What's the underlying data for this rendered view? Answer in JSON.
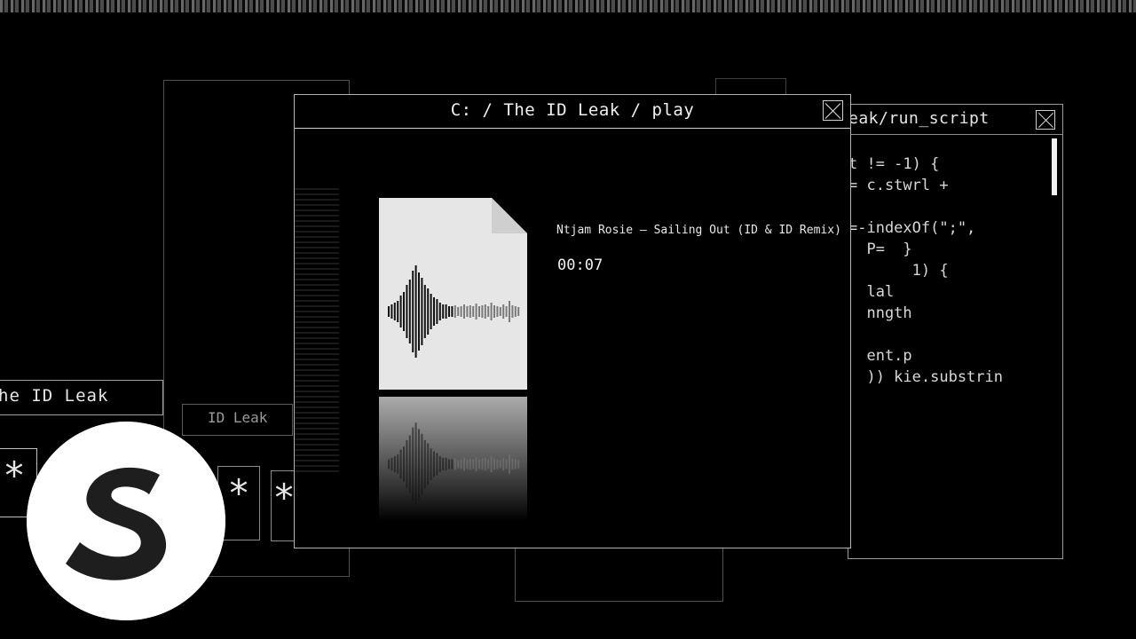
{
  "main_window": {
    "title": "C: / The ID Leak / play",
    "track_name": "Ntjam Rosie – Sailing Out (ID & ID Remix)",
    "elapsed_time": "00:07"
  },
  "script_window": {
    "title": "eak/run_script",
    "code_lines": [
      "t != -1) {",
      "= c.stwrl +",
      "",
      "=-indexOf(\";\",",
      "  P=  }",
      "       1) {",
      "  lal",
      "  nngth",
      "",
      "  ent.p",
      "  )) kie.substrin"
    ]
  },
  "left_window": {
    "title": "he ID Leak",
    "ghost_title": "ID Leak",
    "asterisk": "*"
  },
  "logo": {
    "name": "spinnin-records-logo"
  },
  "colors": {
    "background": "#000000",
    "foreground": "#eaeaea",
    "logo_bg": "#ffffff"
  }
}
